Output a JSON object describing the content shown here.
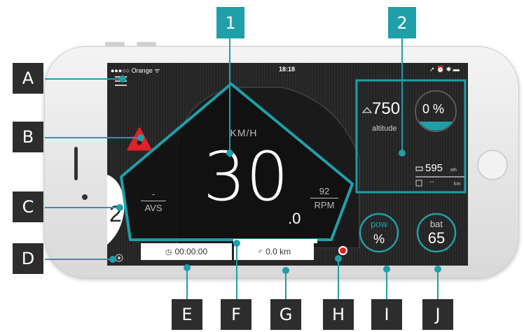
{
  "status_bar": {
    "carrier": "●●●○○ Orange ᯤ",
    "time": "18:18",
    "right_icons": "➚ ⏰ ✱ ▬"
  },
  "speed": {
    "unit": "KM/H",
    "value": "30",
    "decimal": ".0"
  },
  "avs": {
    "value": "-",
    "label": "AVS"
  },
  "rpm": {
    "value": "92",
    "label": "RPM"
  },
  "altitude": {
    "value": "750",
    "label": "altitude"
  },
  "battery_percent": {
    "value": "0 %"
  },
  "energy": {
    "wh_value": "595",
    "wh_unit": "wh",
    "km_value": "--",
    "km_unit": "km"
  },
  "trip": {
    "time": "00:00:00",
    "distance": "0.0 km"
  },
  "gear": {
    "value": "2"
  },
  "pow": {
    "label": "pow",
    "value": "%"
  },
  "bat": {
    "label": "bat",
    "value": "65"
  },
  "markers": {
    "one": "1",
    "two": "2",
    "A": "A",
    "B": "B",
    "C": "C",
    "D": "D",
    "E": "E",
    "F": "F",
    "G": "G",
    "H": "H",
    "I": "I",
    "J": "J"
  },
  "colors": {
    "accent": "#1f9fa8",
    "warning": "#e0202a",
    "record": "#e21b1b",
    "screen_bg": "#262626"
  }
}
